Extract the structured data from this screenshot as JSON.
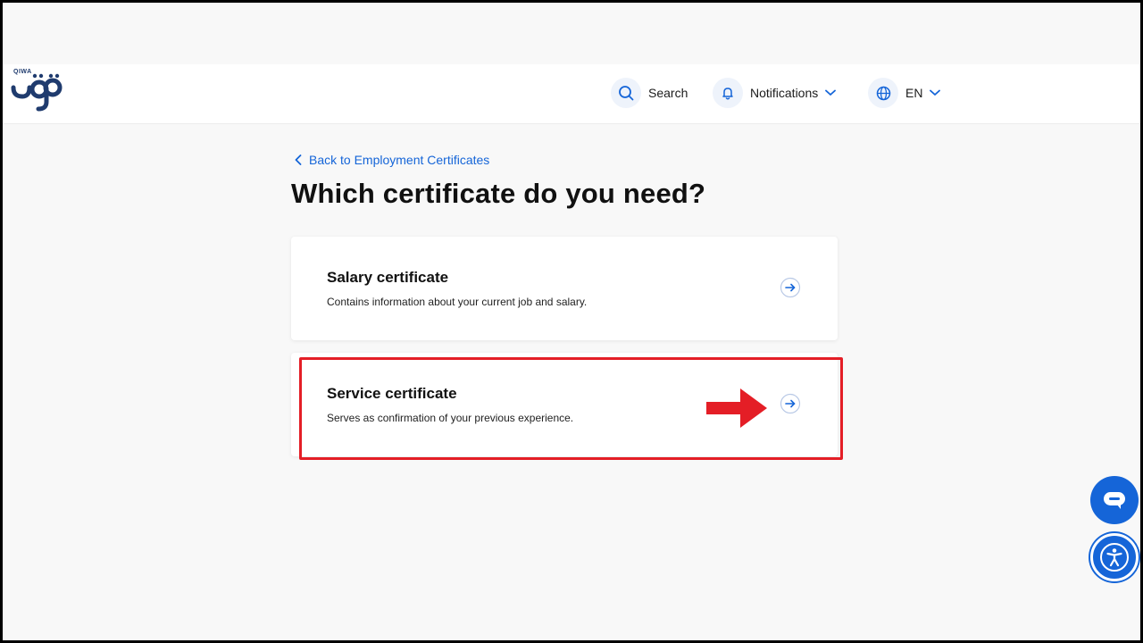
{
  "brand": {
    "logo_text": "QIWA"
  },
  "header": {
    "search_label": "Search",
    "notifications_label": "Notifications",
    "language_label": "EN"
  },
  "main": {
    "back_link": "Back to Employment Certificates",
    "title": "Which certificate do you need?",
    "cards": [
      {
        "title": "Salary certificate",
        "description": "Contains information about your current job and salary."
      },
      {
        "title": "Service certificate",
        "description": "Serves as confirmation of your previous experience."
      }
    ]
  },
  "colors": {
    "accent": "#1565d8",
    "highlight": "#e41e26",
    "brand": "#1f3b6e"
  },
  "icons": [
    "search-icon",
    "bell-icon",
    "globe-icon",
    "chevron-down-icon",
    "chevron-left-icon",
    "arrow-right-icon",
    "chat-icon",
    "accessibility-icon"
  ]
}
